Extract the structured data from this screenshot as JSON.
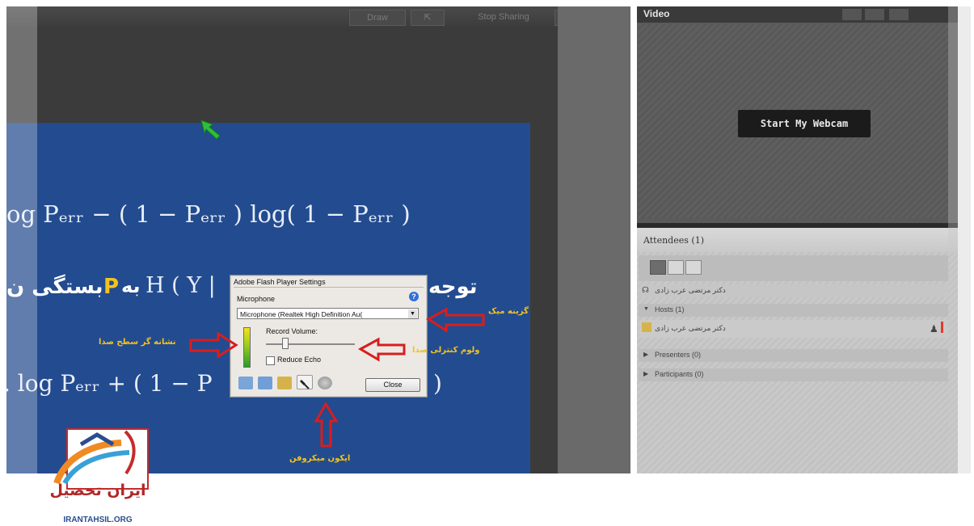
{
  "share_toolbar": {
    "draw_label": "Draw",
    "stop_sharing_label": "Stop Sharing"
  },
  "slide": {
    "line1": "og Pₑᵣᵣ − ( 1 −  Pₑᵣᵣ ) log( 1 −  Pₑᵣᵣ )",
    "line2_persian_right": "توجه",
    "line2_persian_left": "بستگی ن",
    "line2_mid": "H ( Y | ",
    "line2_to": "به",
    "line2_p": "P",
    "line3": ". log Pₑᵣᵣ + ( 1  −  P",
    "line3_end": ")"
  },
  "flash_dialog": {
    "title": "Adobe Flash Player Settings",
    "section": "Microphone",
    "device": "Microphone (Realtek High Definition Au(",
    "record_volume": "Record Volume:",
    "reduce_echo": "Reduce Echo",
    "close": "Close"
  },
  "annotations": {
    "mic_select": "گزینه میک",
    "meter": "نشانه گر سطح صدا",
    "volume": "ولوم کنترلی صدا",
    "mic_icon": "ایکون میکروفن"
  },
  "video_pod": {
    "title": "Video",
    "webcam_button": "Start My Webcam"
  },
  "attendees": {
    "title": "Attendees",
    "count": "(1)",
    "user_row": "دکتر مرتضی عرب زادی",
    "hosts": "Hosts (1)",
    "host_name": "دکتر مرتضی عرب زادی",
    "presenters": "Presenters (0)",
    "participants": "Participants (0)"
  },
  "logo": {
    "persian": "ایران تحصیل",
    "latin": "IRANTAHSIL.ORG"
  },
  "colors": {
    "slide_blue": "#234b8f",
    "annotation_red": "#d81e1e",
    "annotation_yellow": "#f3c21d"
  }
}
